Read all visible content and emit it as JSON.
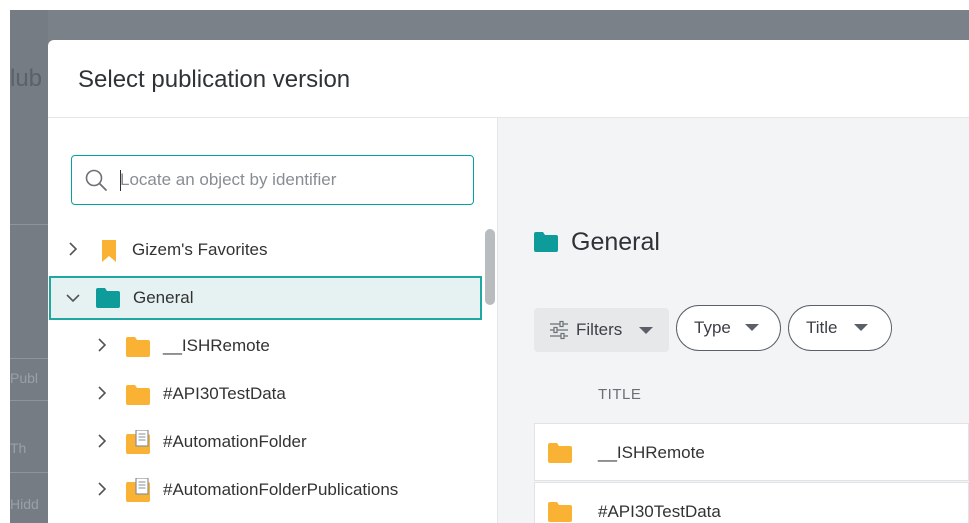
{
  "background": {
    "title_fragment": "lub",
    "left_labels": [
      "Publ",
      "Th",
      "Hidd"
    ]
  },
  "modal": {
    "title": "Select publication version"
  },
  "search": {
    "placeholder": "Locate an object by identifier",
    "value": ""
  },
  "tree": {
    "items": [
      {
        "label": "Gizem's Favorites",
        "icon": "bookmark-icon",
        "expanded": false,
        "selected": false,
        "level": 0
      },
      {
        "label": "General",
        "icon": "folder-teal-icon",
        "expanded": true,
        "selected": true,
        "level": 0
      },
      {
        "label": "__ISHRemote",
        "icon": "folder-icon",
        "expanded": false,
        "selected": false,
        "level": 1
      },
      {
        "label": "#API30TestData",
        "icon": "folder-icon",
        "expanded": false,
        "selected": false,
        "level": 1
      },
      {
        "label": "#AutomationFolder",
        "icon": "publication-folder-icon",
        "expanded": false,
        "selected": false,
        "level": 1
      },
      {
        "label": "#AutomationFolderPublications",
        "icon": "publication-folder-icon",
        "expanded": false,
        "selected": false,
        "level": 1
      }
    ]
  },
  "content": {
    "heading": "General",
    "filters_label": "Filters",
    "type_label": "Type",
    "title_filter_label": "Title",
    "column_title": "TITLE",
    "rows": [
      {
        "label": "__ISHRemote",
        "icon": "folder-icon"
      },
      {
        "label": "#API30TestData",
        "icon": "folder-icon"
      }
    ]
  },
  "colors": {
    "accent": "#1fa8a2",
    "folder": "#f9b233",
    "folder_teal": "#0e9c9a",
    "bookmark": "#f9b233",
    "overlay": "#7b8189"
  }
}
